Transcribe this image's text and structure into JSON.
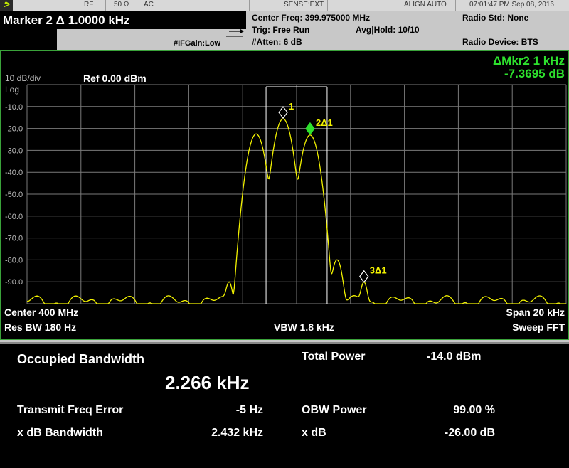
{
  "status_bar": {
    "rf": "RF",
    "impedance": "50 Ω",
    "coupling": "AC",
    "sense": "SENSE:EXT",
    "align": "ALIGN AUTO",
    "datetime": "07:01:47 PM Sep 08, 2016"
  },
  "header": {
    "marker_title": "Marker 2 Δ  1.0000 kHz",
    "center_freq": "Center Freq: 399.975000 MHz",
    "trig": "Trig: Free Run",
    "avg_hold": "Avg|Hold: 10/10",
    "atten": "#Atten: 6 dB",
    "if_gain": "#IFGain:Low",
    "radio_std": "Radio Std: None",
    "radio_device": "Radio Device: BTS"
  },
  "display": {
    "delta_marker_line1": "ΔMkr2  1 kHz",
    "delta_marker_line2": "-7.3695 dB",
    "scale": "10 dB/div",
    "ref_level": "Ref 0.00 dBm",
    "log_label": "Log",
    "y_ticks": [
      "-10.0",
      "-20.0",
      "-30.0",
      "-40.0",
      "-50.0",
      "-60.0",
      "-70.0",
      "-80.0",
      "-90.0"
    ],
    "markers": [
      {
        "label": "1",
        "freq_khz": -0.5,
        "level_dbm": -15.6
      },
      {
        "label": "2Δ1",
        "freq_khz": 0.5,
        "level_dbm": -23.0
      },
      {
        "label": "3Δ1",
        "freq_khz": 2.5,
        "level_dbm": -90.5
      }
    ],
    "center": "Center  400 MHz",
    "res_bw": "Res BW  180 Hz",
    "vbw": "VBW  1.8 kHz",
    "span": "Span 20 kHz",
    "sweep": "Sweep FFT",
    "colors": {
      "trace": "#f2f200",
      "grid": "#7a7a7a",
      "active_marker": "#2de02d",
      "marker_readout": "#2de02d"
    }
  },
  "results": {
    "occupied_bandwidth_label": "Occupied Bandwidth",
    "occupied_bandwidth_value": "2.266 kHz",
    "total_power_label": "Total Power",
    "total_power_value": "-14.0 dBm",
    "transmit_freq_error_label": "Transmit Freq Error",
    "transmit_freq_error_value": "-5 Hz",
    "obw_power_label": "OBW Power",
    "obw_power_value": "99.00 %",
    "x_db_bandwidth_label": "x dB Bandwidth",
    "x_db_bandwidth_value": "2.432 kHz",
    "x_db_label": "x dB",
    "x_db_value": "-26.00 dB"
  }
}
